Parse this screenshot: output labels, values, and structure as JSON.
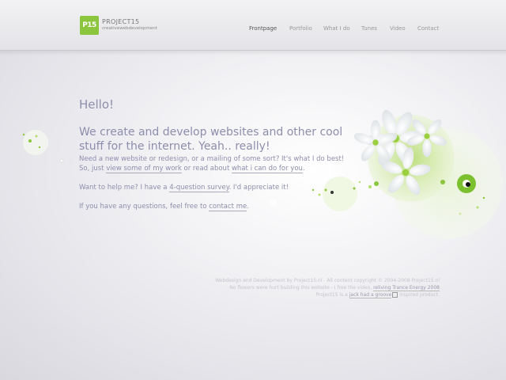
{
  "header": {
    "logo": {
      "mark": "P15",
      "title": "PROJECT15",
      "tagline": "creativewebdevelopment"
    },
    "nav": [
      {
        "label": "Frontpage",
        "active": true
      },
      {
        "label": "Portfolio",
        "active": false
      },
      {
        "label": "What I do",
        "active": false
      },
      {
        "label": "Tunes",
        "active": false
      },
      {
        "label": "Video",
        "active": false
      },
      {
        "label": "Contact",
        "active": false
      }
    ]
  },
  "main": {
    "hello": "Hello!",
    "headline": "We create and develop websites and other cool stuff for the internet. Yeah.. really!",
    "need": {
      "text1": "Need a new website or redesign, or a mailing of some sort? It's what I do best!",
      "text2": "So, just",
      "link1": "view some of my work",
      "text3": "or read about",
      "link2": "what i can do for you",
      "text4": "."
    },
    "help": {
      "text1": "Want to help me? I have a",
      "link": "4-question survey",
      "text2": ". I'd appreciate it!"
    },
    "questions": {
      "text1": "If you have any questions, feel free to",
      "link": "contact me",
      "text2": "."
    }
  },
  "footer": {
    "line1": "Webdesign and Development by Project15.nl - All content copyright © 2004-2008 Project15.nl",
    "line2_text": "No flowers were hurt building this website - I free the video,",
    "line2_link": "reliving Trance Energy 2008",
    "line3_text1": "Project15 is a",
    "line3_link": "jack had a groove",
    "line3_text2": "inspired product."
  },
  "colors": {
    "accent": "#8cc63f",
    "text": "#8d8dad",
    "nav_active": "#555555",
    "nav": "#999999"
  },
  "icons": {
    "logo": "p15-logo-icon",
    "external": "external-link-icon"
  }
}
